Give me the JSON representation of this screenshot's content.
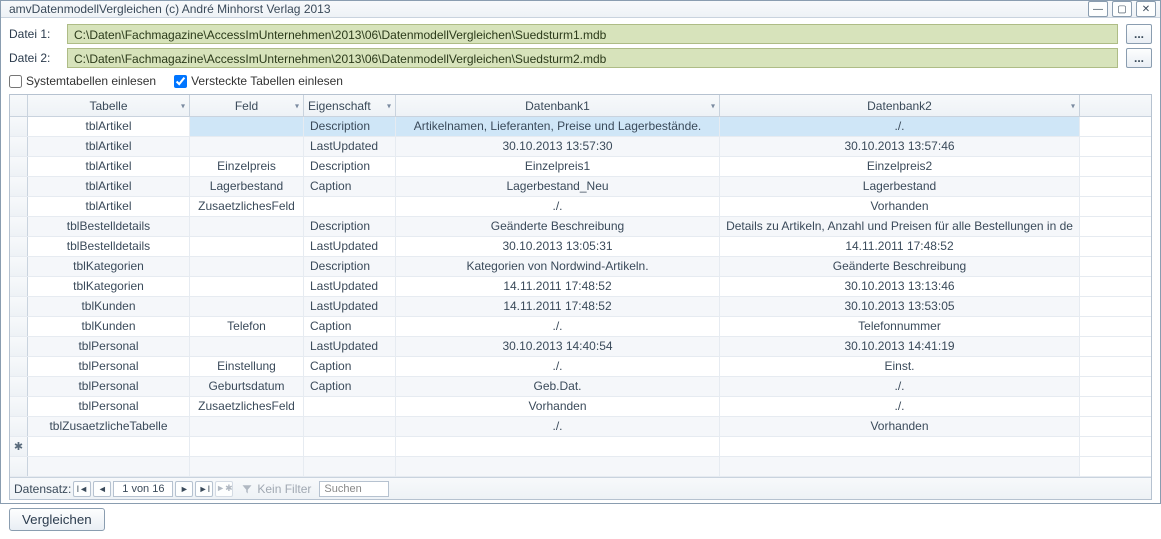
{
  "window": {
    "title": "amvDatenmodellVergleichen (c) André Minhorst Verlag 2013"
  },
  "files": {
    "label1": "Datei 1:",
    "path1": "C:\\Daten\\Fachmagazine\\AccessImUnternehmen\\2013\\06\\DatenmodellVergleichen\\Suedsturm1.mdb",
    "label2": "Datei 2:",
    "path2": "C:\\Daten\\Fachmagazine\\AccessImUnternehmen\\2013\\06\\DatenmodellVergleichen\\Suedsturm2.mdb",
    "browse": "..."
  },
  "options": {
    "systemtables_label": "Systemtabellen einlesen",
    "systemtables_checked": false,
    "hiddentables_label": "Versteckte Tabellen einlesen",
    "hiddentables_checked": true
  },
  "grid": {
    "headers": {
      "tabelle": "Tabelle",
      "feld": "Feld",
      "eigenschaft": "Eigenschaft",
      "db1": "Datenbank1",
      "db2": "Datenbank2"
    },
    "rows": [
      {
        "t": "tblArtikel",
        "f": "",
        "e": "Description",
        "d1": "Artikelnamen, Lieferanten, Preise und Lagerbestände.",
        "d2": "./.",
        "sel": true
      },
      {
        "t": "tblArtikel",
        "f": "",
        "e": "LastUpdated",
        "d1": "30.10.2013 13:57:30",
        "d2": "30.10.2013 13:57:46"
      },
      {
        "t": "tblArtikel",
        "f": "Einzelpreis",
        "e": "Description",
        "d1": "Einzelpreis1",
        "d2": "Einzelpreis2"
      },
      {
        "t": "tblArtikel",
        "f": "Lagerbestand",
        "e": "Caption",
        "d1": "Lagerbestand_Neu",
        "d2": "Lagerbestand"
      },
      {
        "t": "tblArtikel",
        "f": "ZusaetzlichesFeld",
        "e": "",
        "d1": "./.",
        "d2": "Vorhanden"
      },
      {
        "t": "tblBestelldetails",
        "f": "",
        "e": "Description",
        "d1": "Geänderte Beschreibung",
        "d2": "Details zu Artikeln, Anzahl und Preisen für alle Bestellungen in de"
      },
      {
        "t": "tblBestelldetails",
        "f": "",
        "e": "LastUpdated",
        "d1": "30.10.2013 13:05:31",
        "d2": "14.11.2011 17:48:52"
      },
      {
        "t": "tblKategorien",
        "f": "",
        "e": "Description",
        "d1": "Kategorien von Nordwind-Artikeln.",
        "d2": "Geänderte Beschreibung"
      },
      {
        "t": "tblKategorien",
        "f": "",
        "e": "LastUpdated",
        "d1": "14.11.2011 17:48:52",
        "d2": "30.10.2013 13:13:46"
      },
      {
        "t": "tblKunden",
        "f": "",
        "e": "LastUpdated",
        "d1": "14.11.2011 17:48:52",
        "d2": "30.10.2013 13:53:05"
      },
      {
        "t": "tblKunden",
        "f": "Telefon",
        "e": "Caption",
        "d1": "./.",
        "d2": "Telefonnummer"
      },
      {
        "t": "tblPersonal",
        "f": "",
        "e": "LastUpdated",
        "d1": "30.10.2013 14:40:54",
        "d2": "30.10.2013 14:41:19"
      },
      {
        "t": "tblPersonal",
        "f": "Einstellung",
        "e": "Caption",
        "d1": "./.",
        "d2": "Einst."
      },
      {
        "t": "tblPersonal",
        "f": "Geburtsdatum",
        "e": "Caption",
        "d1": "Geb.Dat.",
        "d2": "./."
      },
      {
        "t": "tblPersonal",
        "f": "ZusaetzlichesFeld",
        "e": "",
        "d1": "Vorhanden",
        "d2": "./."
      },
      {
        "t": "tblZusaetzlicheTabelle",
        "f": "",
        "e": "",
        "d1": "./.",
        "d2": "Vorhanden"
      }
    ]
  },
  "nav": {
    "label": "Datensatz:",
    "position": "1 von 16",
    "nofilter": "Kein Filter",
    "search_placeholder": "Suchen"
  },
  "footer": {
    "compare": "Vergleichen"
  }
}
